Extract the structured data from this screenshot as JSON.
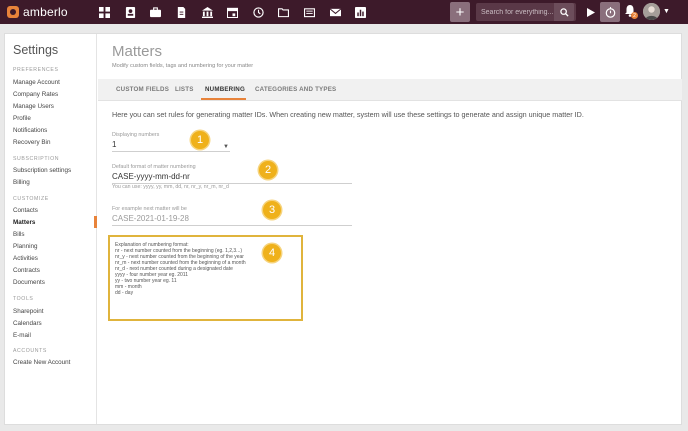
{
  "app": {
    "name": "amberlo",
    "brand_color": "#e8833a",
    "topbar_color": "#3d1a2a"
  },
  "topbar": {
    "nav_icons": [
      "dashboard-icon",
      "contacts-icon",
      "matters-icon",
      "documents-icon",
      "billing-icon",
      "calendar-icon",
      "time-icon",
      "folder-icon",
      "tasks-icon",
      "mail-icon",
      "reports-icon"
    ],
    "add_label": "+",
    "search_placeholder": "Search for everything...",
    "notification_count": "2"
  },
  "sidebar": {
    "title": "Settings",
    "sections": [
      {
        "label": "PREFERENCES",
        "items": [
          "Manage Account",
          "Company Rates",
          "Manage Users",
          "Profile",
          "Notifications",
          "Recovery Bin"
        ]
      },
      {
        "label": "SUBSCRIPTION",
        "items": [
          "Subscription settings",
          "Billing"
        ]
      },
      {
        "label": "CUSTOMIZE",
        "items": [
          "Contacts",
          "Matters",
          "Bills",
          "Planning",
          "Activities",
          "Contracts",
          "Documents"
        ]
      },
      {
        "label": "TOOLS",
        "items": [
          "Sharepoint",
          "Calendars",
          "E-mail"
        ]
      },
      {
        "label": "ACCOUNTS",
        "items": [
          "Create New Account"
        ]
      }
    ],
    "active_item": "Matters"
  },
  "main": {
    "title": "Matters",
    "subtitle": "Modify custom fields, tags and numbering for your matter",
    "tabs": [
      "CUSTOM FIELDS",
      "LISTS",
      "NUMBERING",
      "CATEGORIES AND TYPES"
    ],
    "active_tab": "NUMBERING",
    "intro": "Here you can set rules for generating matter IDs. When creating new matter, system will use these settings to generate and assign unique matter ID.",
    "displaying_numbers": {
      "label": "Displaying numbers",
      "value": "1"
    },
    "default_format": {
      "label": "Default format of matter numbering",
      "value": "CASE-yyyy-mm-dd-nr",
      "hint": "You can use: yyyy, yy, mm, dd, nr, nr_y, nr_m, nr_d"
    },
    "example": {
      "label": "For example next matter will be",
      "value": "CASE-2021-01-19-28"
    },
    "explanation": {
      "title": "Explanation of numbering format:",
      "lines": [
        "nr - next number counted from the beginning (eg. 1,2,3...)",
        "nr_y - next number counted from the beginning of the year",
        "nr_m - next number counted from the beginning of a month",
        "nr_d - next number counted during a designated date",
        "yyyy - four number year eg. 2011",
        "yy - two number year eg. 11",
        "mm - month",
        "dd - day"
      ]
    }
  },
  "callouts": [
    "1",
    "2",
    "3",
    "4"
  ],
  "colors": {
    "callout": "#efb11b",
    "highlight_border": "#e0b43c"
  }
}
